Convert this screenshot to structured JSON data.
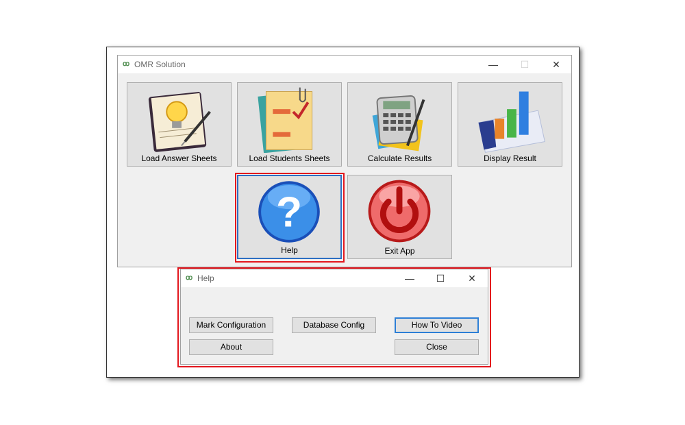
{
  "main_window": {
    "title": "OMR Solution",
    "app_icon": "omr-app-icon",
    "controls": {
      "minimize": "—",
      "maximize": "☐",
      "close": "✕"
    },
    "tiles": [
      {
        "label": "Load Answer Sheets",
        "icon": "lightbulb-notepad-icon"
      },
      {
        "label": "Load Students Sheets",
        "icon": "checklist-clipboard-icon"
      },
      {
        "label": "Calculate Results",
        "icon": "calculator-icon"
      },
      {
        "label": "Display Result",
        "icon": "bar-chart-icon"
      },
      {
        "label": "Help",
        "icon": "question-mark-icon"
      },
      {
        "label": "Exit App",
        "icon": "power-icon"
      }
    ]
  },
  "help_dialog": {
    "title": "Help",
    "controls": {
      "minimize": "—",
      "maximize": "☐",
      "close": "✕"
    },
    "buttons": {
      "mark_configuration": "Mark Configuration",
      "database_config": "Database Config",
      "how_to_video": "How To Video",
      "about": "About",
      "close": "Close"
    }
  },
  "colors": {
    "highlight": "#e3161d",
    "focus": "#2d6fc3"
  }
}
